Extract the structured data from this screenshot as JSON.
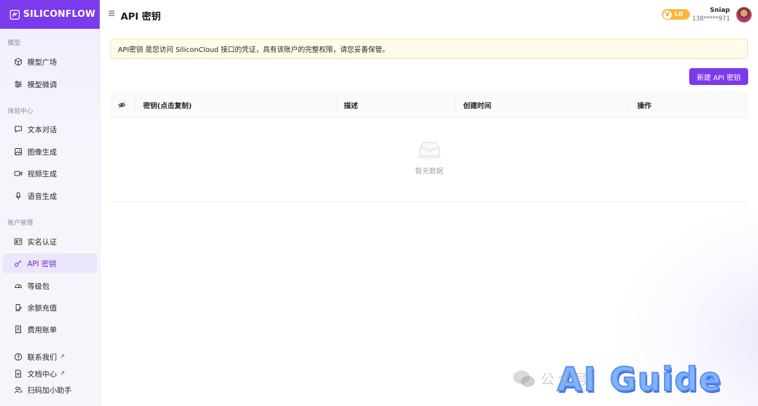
{
  "brand": {
    "name": "SILICONFLOW",
    "color": "#7c3aed"
  },
  "sidebar": {
    "sections": [
      {
        "label": "模型"
      },
      {
        "label": "体验中心"
      },
      {
        "label": "账户管理"
      }
    ],
    "items": [
      {
        "label": "模型广场",
        "icon": "cube-icon"
      },
      {
        "label": "模型微调",
        "icon": "sliders-icon"
      },
      {
        "label": "文本对话",
        "icon": "chat-icon"
      },
      {
        "label": "图像生成",
        "icon": "image-icon"
      },
      {
        "label": "视频生成",
        "icon": "video-icon"
      },
      {
        "label": "语音生成",
        "icon": "mic-icon"
      },
      {
        "label": "实名认证",
        "icon": "id-card-icon"
      },
      {
        "label": "API 密钥",
        "icon": "key-icon",
        "active": true
      },
      {
        "label": "等级包",
        "icon": "gauge-icon"
      },
      {
        "label": "余额充值",
        "icon": "recharge-icon"
      },
      {
        "label": "费用账单",
        "icon": "bill-icon"
      },
      {
        "label": "联系我们",
        "icon": "help-circle-icon",
        "external": "↗"
      },
      {
        "label": "文档中心",
        "icon": "doc-icon",
        "external": "↗"
      },
      {
        "label": "扫码加小助手",
        "icon": "users-icon"
      }
    ]
  },
  "header": {
    "title": "API 密钥",
    "level": {
      "prefix": "V",
      "label": "L0"
    },
    "user": {
      "name": "Sniap",
      "phone": "138*****971"
    }
  },
  "notice": {
    "text": "API密钥 是您访问 SiliconCloud 接口的凭证，具有该账户的完整权限，请您妥善保管。"
  },
  "actions": {
    "new_key": "新建 API 密钥"
  },
  "table": {
    "columns": [
      "密钥(点击复制)",
      "描述",
      "创建时间",
      "操作"
    ],
    "rows": [],
    "empty_text": "暂无数据"
  },
  "watermark": {
    "text": "AI Guide",
    "sub": "公众号"
  }
}
